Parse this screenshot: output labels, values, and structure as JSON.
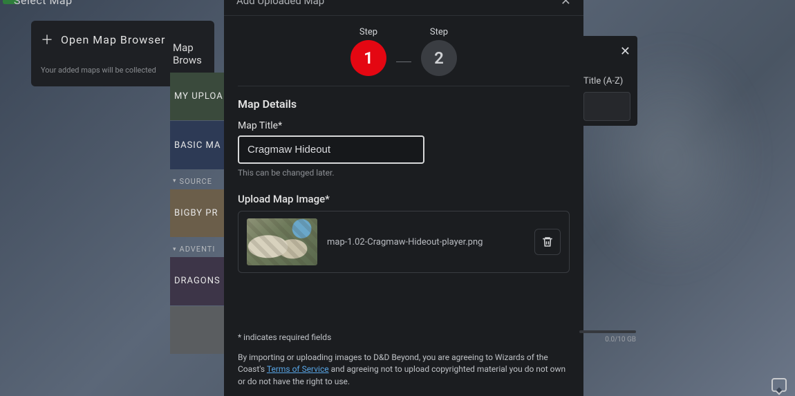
{
  "top": {
    "select_map": "Select Map"
  },
  "left": {
    "open_browser": "Open Map Browser",
    "note": "Your added maps will be collected"
  },
  "browser": {
    "title": "Map Brows",
    "my_uploads": "MY UPLOA",
    "basic": "BASIC MA",
    "source_label": "SOURCE",
    "bigby": "BIGBY PR",
    "adventure_label": "ADVENTI",
    "dragons": "DRAGONS"
  },
  "modal": {
    "title": "Add Uploaded Map",
    "step_label": "Step",
    "step1": "1",
    "step2": "2",
    "details_heading": "Map Details",
    "title_label": "Map Title*",
    "title_value": "Cragmaw Hideout",
    "title_hint": "This can be changed later.",
    "upload_label": "Upload Map Image*",
    "file_name": "map-1.02-Cragmaw-Hideout-player.png",
    "required_note": "* indicates required fields",
    "legal_pre": "By importing or uploading images to D&D Beyond, you are agreeing to Wizards of the Coast's ",
    "tos": "Terms of Service",
    "legal_post": " and agreeing not to upload copyrighted material you do not own or do not have the right to use."
  },
  "right": {
    "sort": "Title (A-Z)"
  },
  "storage": {
    "text": "0.0/10 GB"
  }
}
